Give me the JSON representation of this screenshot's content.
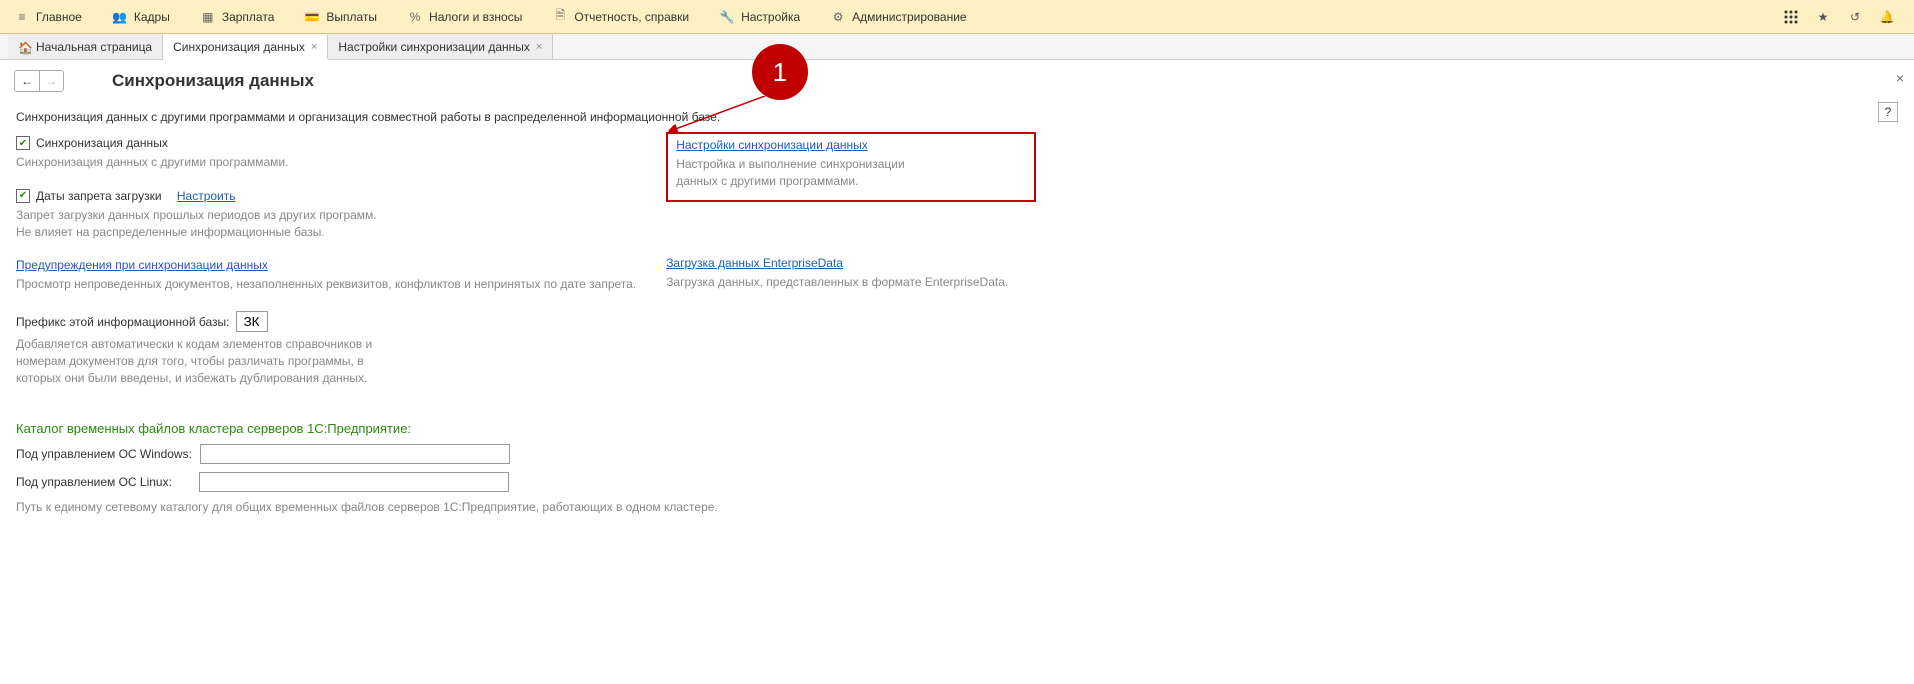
{
  "menubar": {
    "items": [
      {
        "label": "Главное",
        "icon": "menu"
      },
      {
        "label": "Кадры",
        "icon": "people"
      },
      {
        "label": "Зарплата",
        "icon": "grid"
      },
      {
        "label": "Выплаты",
        "icon": "wallet"
      },
      {
        "label": "Налоги и взносы",
        "icon": "percent"
      },
      {
        "label": "Отчетность, справки",
        "icon": "doc"
      },
      {
        "label": "Настройка",
        "icon": "wrench"
      },
      {
        "label": "Администрирование",
        "icon": "gear"
      }
    ]
  },
  "tabs": [
    {
      "label": "Начальная страница",
      "home": true,
      "closable": false
    },
    {
      "label": "Синхронизация данных",
      "closable": true,
      "active": true
    },
    {
      "label": "Настройки синхронизации данных",
      "closable": true
    }
  ],
  "page": {
    "title": "Синхронизация данных",
    "intro": "Синхронизация данных с другими программами и организация совместной работы в распределенной информационной базе.",
    "help": "?"
  },
  "left": {
    "sync_checkbox": "Синхронизация данных",
    "sync_desc": "Синхронизация данных с другими программами.",
    "dates_checkbox": "Даты запрета загрузки",
    "dates_link": "Настроить",
    "dates_desc": "Запрет загрузки данных прошлых периодов из других программ.\nНе влияет на распределенные информационные базы.",
    "warn_link": "Предупреждения при синхронизации данных",
    "warn_desc": "Просмотр непроведенных документов, незаполненных реквизитов, конфликтов и непринятых по дате запрета.",
    "prefix_label": "Префикс этой информационной базы:",
    "prefix_value": "ЗК",
    "prefix_desc": "Добавляется автоматически к кодам элементов справочников и номерам документов для того, чтобы различать программы, в которых они были введены, и избежать дублирования данных."
  },
  "right": {
    "settings_link": "Настройки синхронизации данных",
    "settings_desc": "Настройка и выполнение синхронизации данных с другими программами.",
    "load_link": "Загрузка данных EnterpriseData",
    "load_desc": "Загрузка данных, представленных в формате EnterpriseData."
  },
  "cluster": {
    "title": "Каталог временных файлов кластера серверов 1С:Предприятие:",
    "win_label": "Под управлением ОС Windows:",
    "win_value": "",
    "linux_label": "Под управлением ОС Linux:",
    "linux_value": "",
    "hint": "Путь к единому сетевому каталогу для общих временных файлов серверов 1С:Предприятие, работающих в одном кластере."
  },
  "annotation": {
    "number": "1"
  }
}
